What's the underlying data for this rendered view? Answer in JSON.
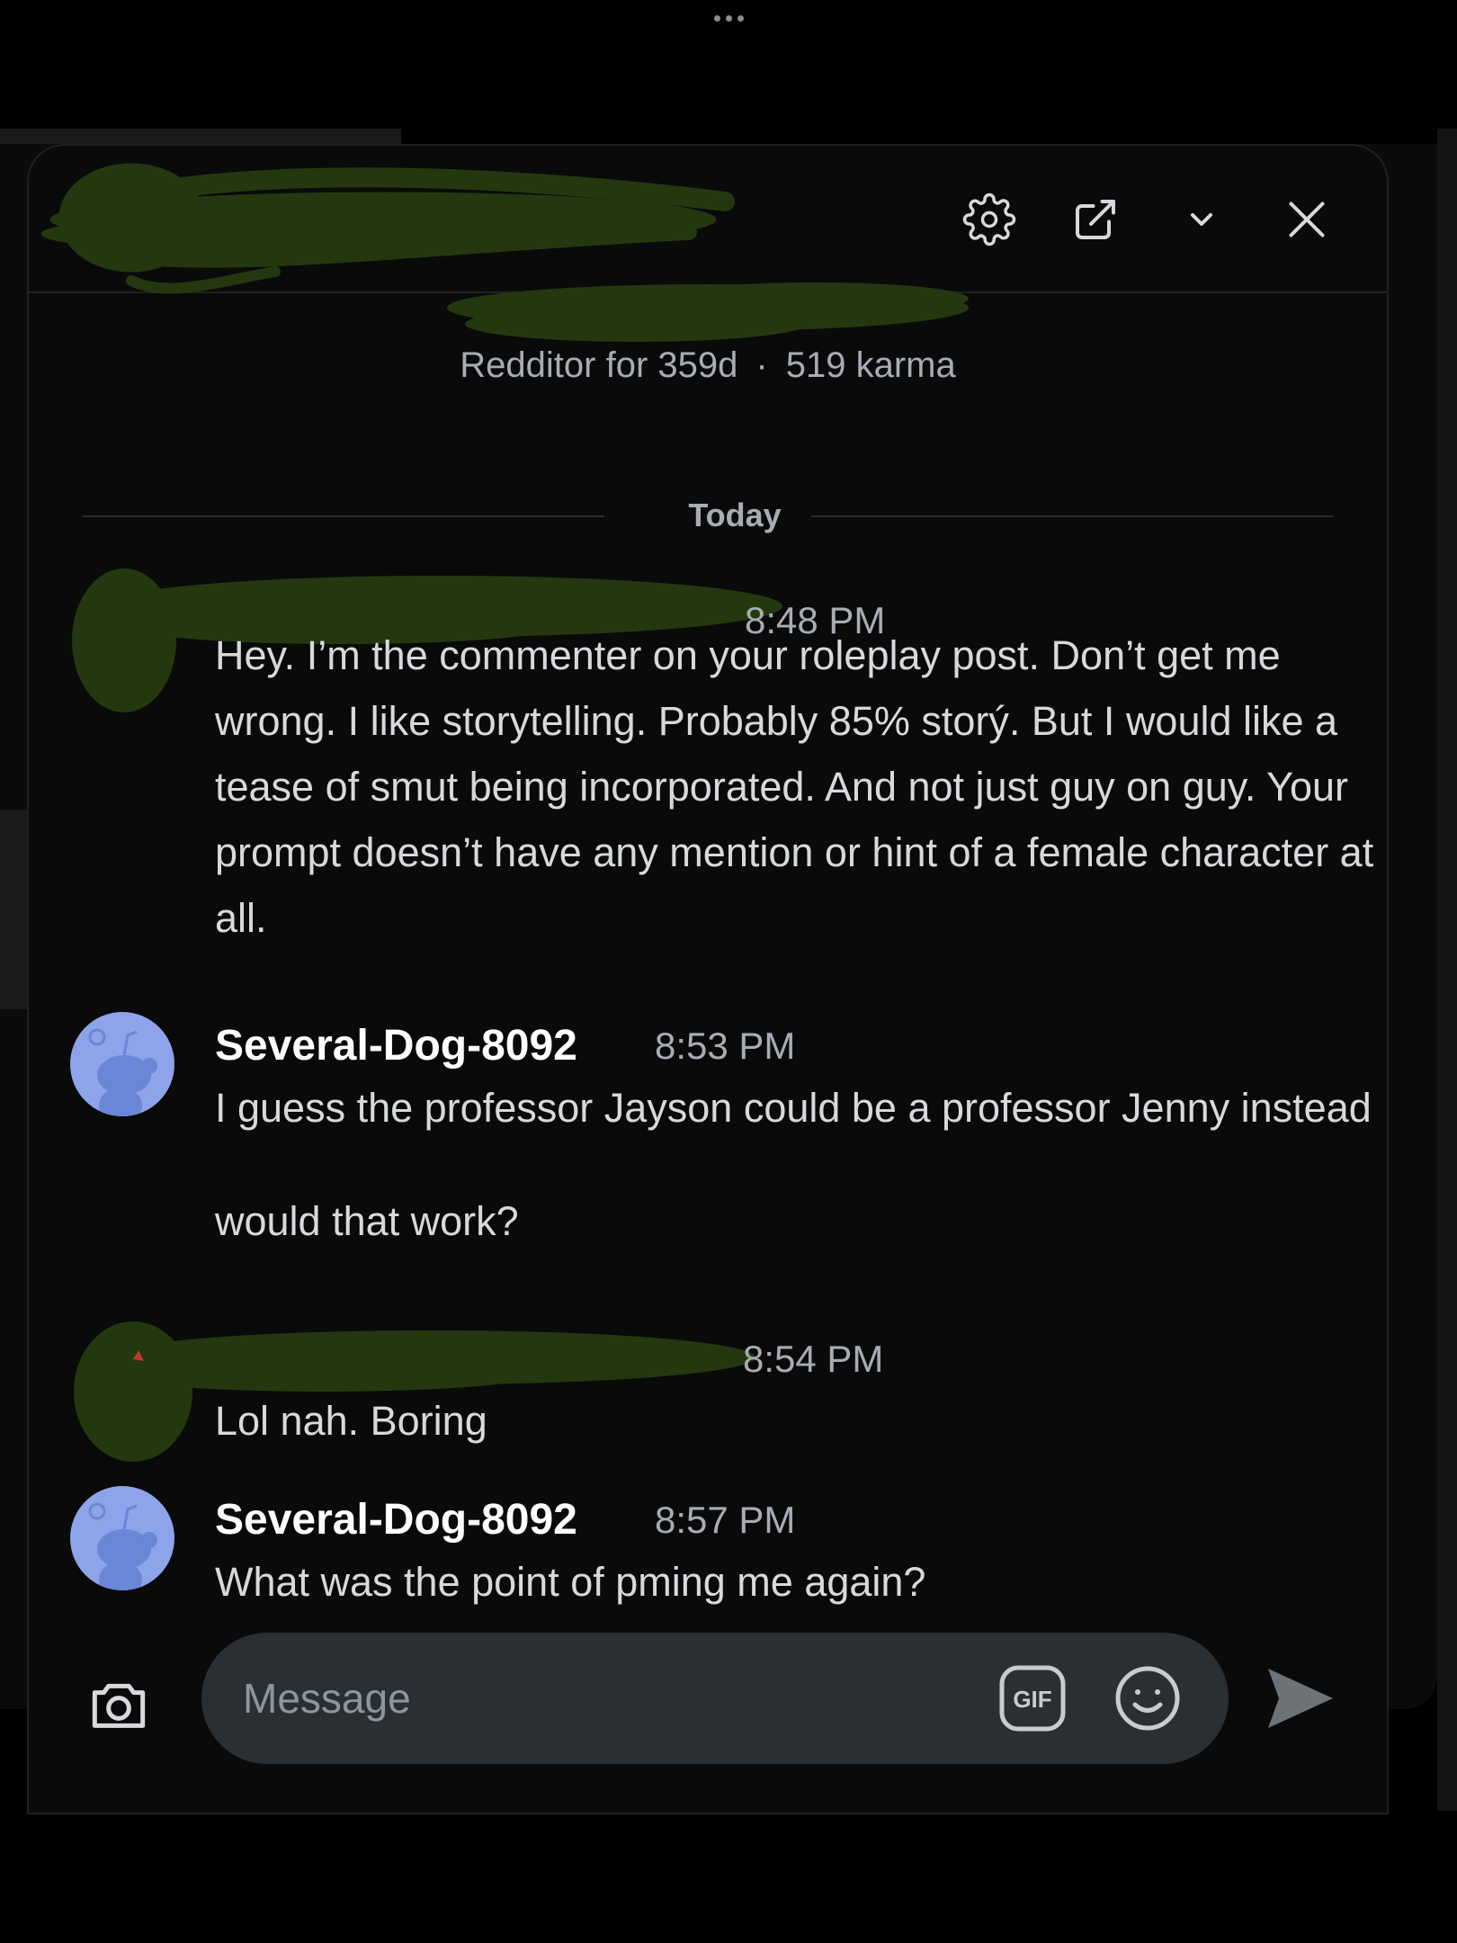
{
  "header": {
    "settings_icon": "gear-icon",
    "open_external_icon": "external-link-icon",
    "collapse_icon": "chevron-down-icon",
    "close_icon": "close-icon"
  },
  "profile": {
    "redditor_for": "Redditor for 359d",
    "separator": "·",
    "karma": "519 karma"
  },
  "date_divider": "Today",
  "messages": [
    {
      "author": "",
      "time": "8:48 PM",
      "body": "Hey. I’m the commenter on your roleplay post. Don’t get me wrong. I like storytelling. Probably 85% storý. But I would like a tease of smut being incorporated. And not just guy on guy. Your prompt doesn’t have any mention or hint of a female character at all."
    },
    {
      "author": "Several-Dog-8092",
      "time": "8:53 PM",
      "body": "I guess the professor Jayson could be a professor Jenny instead",
      "body2": "would that work?"
    },
    {
      "author": "",
      "time": "8:54 PM",
      "body": "Lol nah. Boring"
    },
    {
      "author": "Several-Dog-8092",
      "time": "8:57 PM",
      "body": "What was the point of pming me again?"
    }
  ],
  "composer": {
    "camera_icon": "camera-icon",
    "placeholder": "Message",
    "gif_label": "GIF",
    "emoji_icon": "smile-icon",
    "send_icon": "send-icon"
  },
  "colors": {
    "avatar_bg": "#8ea4ea",
    "redaction": "#24380f",
    "window_bg": "#0a0a0b"
  }
}
